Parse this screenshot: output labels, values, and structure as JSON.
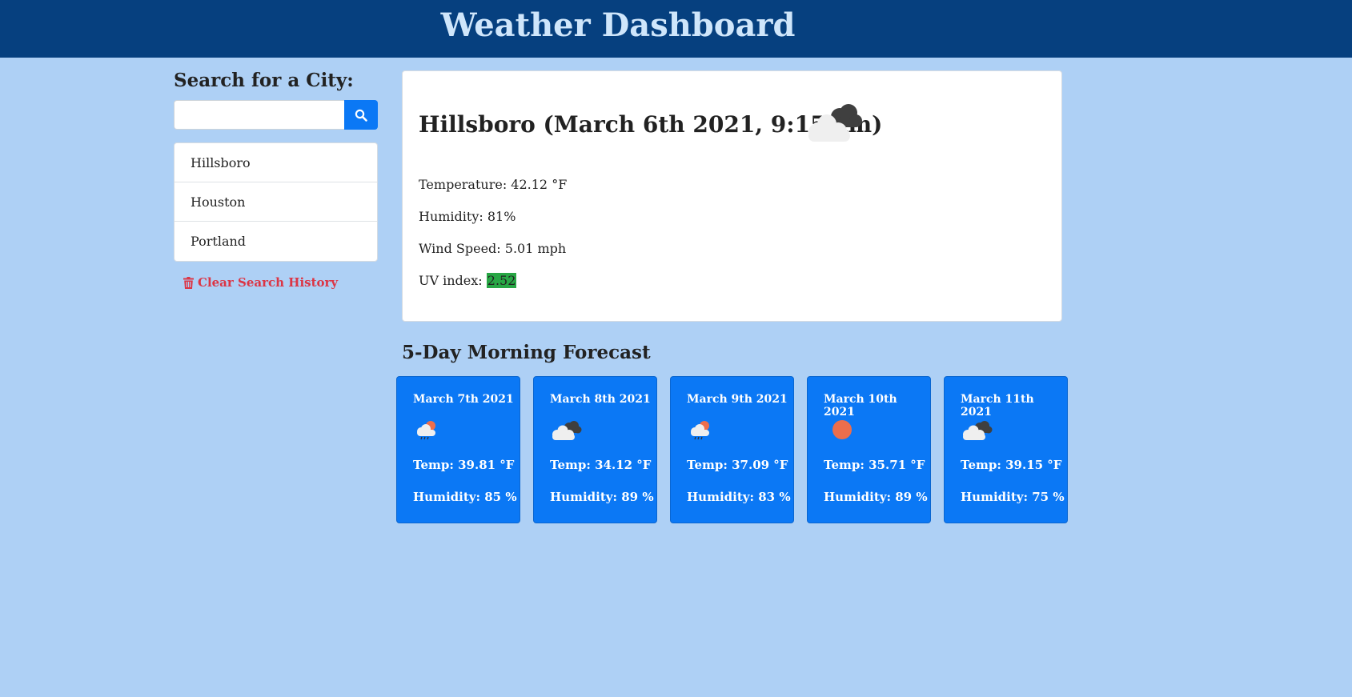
{
  "header": {
    "title": "Weather Dashboard"
  },
  "search": {
    "heading": "Search for a City:",
    "value": "",
    "placeholder": "",
    "button_icon": "search-icon"
  },
  "history": {
    "items": [
      {
        "label": "Hillsboro"
      },
      {
        "label": "Houston"
      },
      {
        "label": "Portland"
      }
    ],
    "clear_label": "Clear Search History",
    "clear_icon": "trash-icon"
  },
  "current": {
    "heading": "Hillsboro (March 6th 2021, 9:15 am)",
    "icon": "broken-clouds-icon",
    "temperature": "Temperature: 42.12 °F",
    "humidity": "Humidity: 81%",
    "wind": "Wind Speed: 5.01 mph",
    "uv_label": "UV index:",
    "uv_value": "2.52",
    "uv_color": "#28a745"
  },
  "forecast": {
    "heading": "5-Day Morning Forecast",
    "days": [
      {
        "date": "March 7th 2021",
        "icon": "rain-sun-icon",
        "temp": "Temp: 39.81 °F",
        "humidity": "Humidity: 85 %"
      },
      {
        "date": "March 8th 2021",
        "icon": "broken-clouds-icon",
        "temp": "Temp: 34.12 °F",
        "humidity": "Humidity: 89 %"
      },
      {
        "date": "March 9th 2021",
        "icon": "rain-sun-icon",
        "temp": "Temp: 37.09 °F",
        "humidity": "Humidity: 83 %"
      },
      {
        "date": "March 10th 2021",
        "icon": "sun-icon",
        "temp": "Temp: 35.71 °F",
        "humidity": "Humidity: 89 %"
      },
      {
        "date": "March 11th 2021",
        "icon": "broken-clouds-icon",
        "temp": "Temp: 39.15 °F",
        "humidity": "Humidity: 75 %"
      }
    ]
  },
  "colors": {
    "header_bg": "#06407f",
    "page_bg": "#aed0f5",
    "accent": "#0b78f5",
    "danger": "#dc3545"
  }
}
